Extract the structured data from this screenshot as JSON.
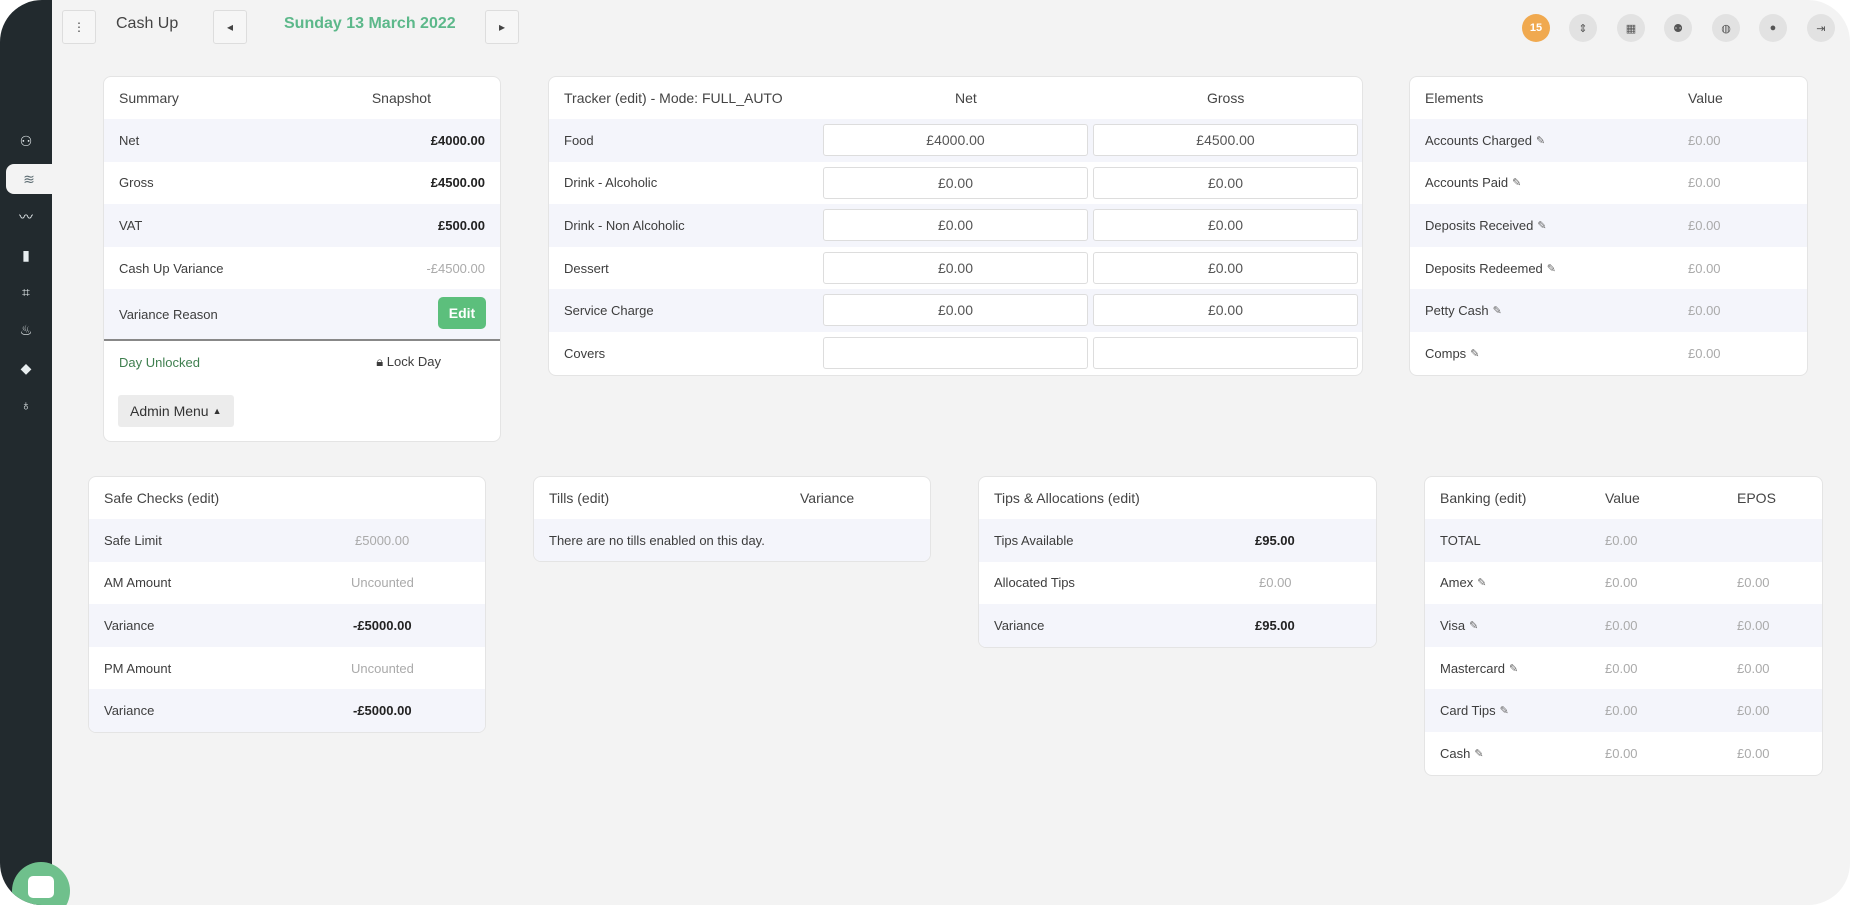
{
  "topbar": {
    "menu_icon": "⋮",
    "title": "Cash Up",
    "date": "Sunday 13 March 2022",
    "prev_icon": "◂",
    "next_icon": "▸",
    "notification_count": "15",
    "icons": [
      "sort-icon",
      "grid-icon",
      "users-icon",
      "globe-icon",
      "user-icon",
      "logout-icon"
    ]
  },
  "sidebar": {
    "icons": [
      "user-icon",
      "layers-icon",
      "chart-line-icon",
      "book-icon",
      "tag-icon",
      "fire-icon",
      "diamond-icon",
      "bulb-icon"
    ]
  },
  "summary": {
    "header": "Summary",
    "header_col": "Snapshot",
    "rows": [
      {
        "label": "Net",
        "value": "£4000.00"
      },
      {
        "label": "Gross",
        "value": "£4500.00"
      },
      {
        "label": "VAT",
        "value": "£500.00"
      },
      {
        "label": "Cash Up Variance",
        "value": "-£4500.00"
      }
    ],
    "variance_reason": "Variance Reason",
    "edit_label": "Edit",
    "day_status": "Day Unlocked",
    "lock_label": "Lock Day",
    "admin_label": "Admin Menu"
  },
  "tracker": {
    "header": "Tracker (edit) - Mode: FULL_AUTO",
    "col_net": "Net",
    "col_gross": "Gross",
    "rows": [
      {
        "label": "Food",
        "net": "£4000.00",
        "gross": "£4500.00"
      },
      {
        "label": "Drink - Alcoholic",
        "net": "£0.00",
        "gross": "£0.00"
      },
      {
        "label": "Drink - Non Alcoholic",
        "net": "£0.00",
        "gross": "£0.00"
      },
      {
        "label": "Dessert",
        "net": "£0.00",
        "gross": "£0.00"
      },
      {
        "label": "Service Charge",
        "net": "£0.00",
        "gross": "£0.00"
      },
      {
        "label": "Covers",
        "net": "",
        "gross": ""
      }
    ]
  },
  "elements": {
    "header": "Elements",
    "header_col": "Value",
    "rows": [
      {
        "label": "Accounts Charged",
        "value": "£0.00"
      },
      {
        "label": "Accounts Paid",
        "value": "£0.00"
      },
      {
        "label": "Deposits Received",
        "value": "£0.00"
      },
      {
        "label": "Deposits Redeemed",
        "value": "£0.00"
      },
      {
        "label": "Petty Cash",
        "value": "£0.00"
      },
      {
        "label": "Comps",
        "value": "£0.00"
      }
    ]
  },
  "safe": {
    "header": "Safe Checks (edit)",
    "rows": [
      {
        "label": "Safe Limit",
        "value": "£5000.00"
      },
      {
        "label": "AM Amount",
        "value": "Uncounted"
      },
      {
        "label": "Variance",
        "value": "-£5000.00"
      },
      {
        "label": "PM Amount",
        "value": "Uncounted"
      },
      {
        "label": "Variance",
        "value": "-£5000.00"
      }
    ]
  },
  "tills": {
    "header": "Tills (edit)",
    "header_col": "Variance",
    "empty": "There are no tills enabled on this day."
  },
  "tips": {
    "header": "Tips & Allocations (edit)",
    "rows": [
      {
        "label": "Tips Available",
        "value": "£95.00"
      },
      {
        "label": "Allocated Tips",
        "value": "£0.00"
      },
      {
        "label": "Variance",
        "value": "£95.00"
      }
    ]
  },
  "banking": {
    "header": "Banking (edit)",
    "col_value": "Value",
    "col_epos": "EPOS",
    "rows": [
      {
        "label": "TOTAL",
        "value": "£0.00",
        "epos": ""
      },
      {
        "label": "Amex",
        "value": "£0.00",
        "epos": "£0.00"
      },
      {
        "label": "Visa",
        "value": "£0.00",
        "epos": "£0.00"
      },
      {
        "label": "Mastercard",
        "value": "£0.00",
        "epos": "£0.00"
      },
      {
        "label": "Card Tips",
        "value": "£0.00",
        "epos": "£0.00"
      },
      {
        "label": "Cash",
        "value": "£0.00",
        "epos": "£0.00"
      }
    ]
  }
}
